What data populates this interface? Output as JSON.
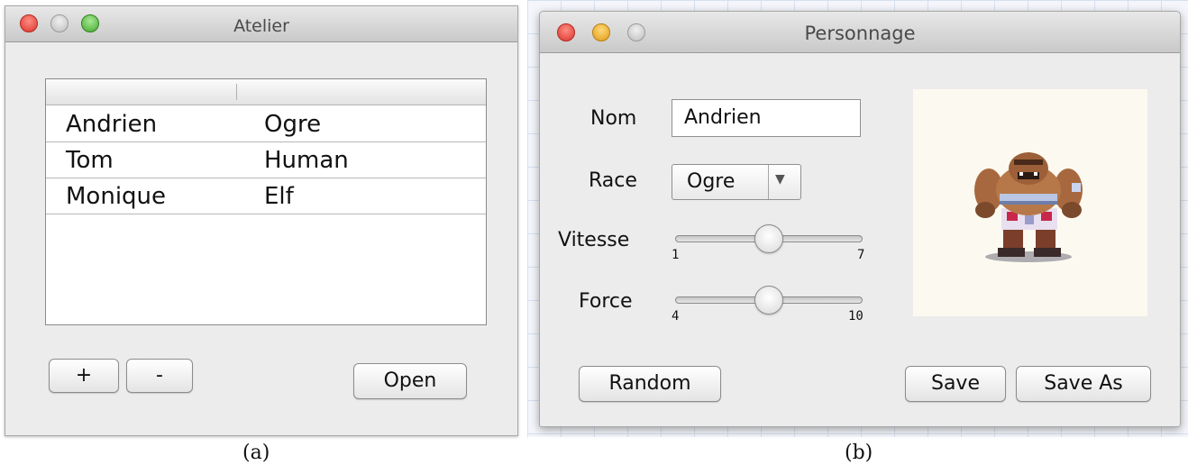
{
  "atelier": {
    "title": "Atelier",
    "table": {
      "rows": [
        {
          "name": "Andrien",
          "race": "Ogre"
        },
        {
          "name": "Tom",
          "race": "Human"
        },
        {
          "name": "Monique",
          "race": "Elf"
        }
      ]
    },
    "buttons": {
      "add": "+",
      "remove": "-",
      "open": "Open"
    }
  },
  "personnage": {
    "title": "Personnage",
    "nom_label": "Nom",
    "nom_value": "Andrien",
    "race_label": "Race",
    "race_value": "Ogre",
    "vitesse": {
      "label": "Vitesse",
      "min": "1",
      "max": "7",
      "value": 4
    },
    "force": {
      "label": "Force",
      "min": "4",
      "max": "10",
      "value": 7
    },
    "buttons": {
      "random": "Random",
      "save": "Save",
      "save_as": "Save As"
    },
    "preview_icon": "ogre-sprite"
  },
  "captions": {
    "a": "(a)",
    "b": "(b)"
  },
  "colors": {
    "red_light": "#d8362c",
    "yellow_light": "#e09a17",
    "green_light": "#42a92c",
    "preview_bg": "#fcfaf0"
  }
}
